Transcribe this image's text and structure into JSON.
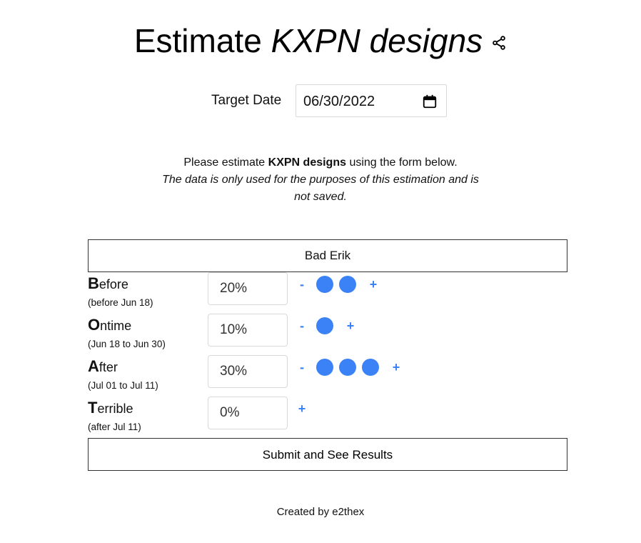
{
  "header": {
    "title_plain": "Estimate",
    "title_emph": "KXPN designs",
    "share_icon": "share-icon"
  },
  "target_date": {
    "label": "Target Date",
    "value": "06/30/2022",
    "icon": "calendar-icon"
  },
  "intro": {
    "prefix": "Please estimate ",
    "bold": "KXPN designs",
    "suffix": " using the form below.",
    "note": "The data is only used for the purposes of this estimation and is not saved."
  },
  "name": "Bad Erik",
  "rows": [
    {
      "initial": "B",
      "rest": "efore",
      "sub": "(before Jun 18)",
      "value": "20%",
      "dots": 2,
      "show_minus": true
    },
    {
      "initial": "O",
      "rest": "ntime",
      "sub": "(Jun 18 to Jun 30)",
      "value": "10%",
      "dots": 1,
      "show_minus": true
    },
    {
      "initial": "A",
      "rest": "fter",
      "sub": "(Jul 01 to Jul 11)",
      "value": "30%",
      "dots": 3,
      "show_minus": true
    },
    {
      "initial": "T",
      "rest": "errible",
      "sub": "(after Jul 11)",
      "value": "0%",
      "dots": 0,
      "show_minus": false
    }
  ],
  "controls": {
    "minus": "-",
    "plus": "+"
  },
  "submit_label": "Submit and See Results",
  "footer": "Created by e2thex",
  "colors": {
    "accent": "#3b82f6"
  }
}
